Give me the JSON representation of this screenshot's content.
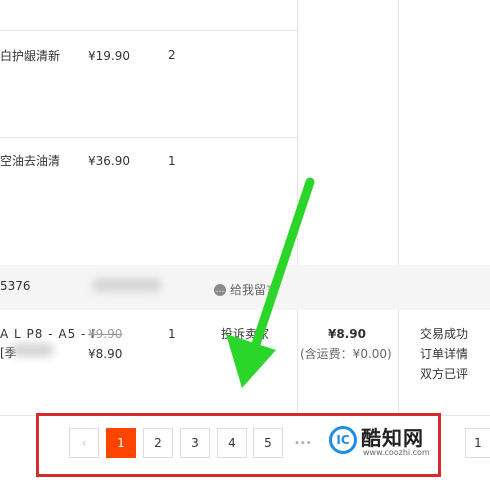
{
  "items": [
    {
      "title": "白护龈清新",
      "price": "¥19.90",
      "qty": "2"
    },
    {
      "title": "空油去油清",
      "price": "¥36.90",
      "qty": "1"
    }
  ],
  "order": {
    "id_fragment": "5376",
    "message_icon": "speech-bubble-icon",
    "message_label": "给我留言",
    "title_fragment": "A L P8 - A5 - I",
    "title_fragment2": "[季",
    "original_price": "¥9.90",
    "price": "¥8.90",
    "qty": "1",
    "complaint": "投诉卖家",
    "total": "¥8.90",
    "shipping": "(含运费：¥0.00)",
    "status": "交易成功",
    "detail_link": "订单详情",
    "review_status": "双方已评"
  },
  "pager": {
    "prev": "‹",
    "pages": [
      "1",
      "2",
      "3",
      "4",
      "5"
    ],
    "active": "1",
    "ellipsis": "•••",
    "jump_value": "1"
  },
  "watermark": {
    "name": "酷知网",
    "url": "www.coozhi.com",
    "mark": "IC"
  },
  "colors": {
    "active_page": "#ff4400",
    "annotation_box": "#d52b2b",
    "arrow": "#2bd62b"
  }
}
